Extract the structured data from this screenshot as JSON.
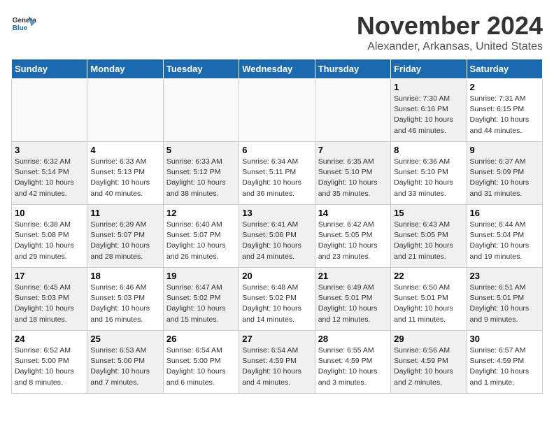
{
  "header": {
    "logo_general": "General",
    "logo_blue": "Blue",
    "month": "November 2024",
    "location": "Alexander, Arkansas, United States"
  },
  "weekdays": [
    "Sunday",
    "Monday",
    "Tuesday",
    "Wednesday",
    "Thursday",
    "Friday",
    "Saturday"
  ],
  "days": [
    {
      "num": "",
      "info": "",
      "empty": true
    },
    {
      "num": "",
      "info": "",
      "empty": true
    },
    {
      "num": "",
      "info": "",
      "empty": true
    },
    {
      "num": "",
      "info": "",
      "empty": true
    },
    {
      "num": "",
      "info": "",
      "empty": true
    },
    {
      "num": "1",
      "info": "Sunrise: 7:30 AM\nSunset: 6:16 PM\nDaylight: 10 hours\nand 46 minutes.",
      "shaded": true
    },
    {
      "num": "2",
      "info": "Sunrise: 7:31 AM\nSunset: 6:15 PM\nDaylight: 10 hours\nand 44 minutes.",
      "shaded": false
    },
    {
      "num": "3",
      "info": "Sunrise: 6:32 AM\nSunset: 5:14 PM\nDaylight: 10 hours\nand 42 minutes.",
      "shaded": true
    },
    {
      "num": "4",
      "info": "Sunrise: 6:33 AM\nSunset: 5:13 PM\nDaylight: 10 hours\nand 40 minutes.",
      "shaded": false
    },
    {
      "num": "5",
      "info": "Sunrise: 6:33 AM\nSunset: 5:12 PM\nDaylight: 10 hours\nand 38 minutes.",
      "shaded": true
    },
    {
      "num": "6",
      "info": "Sunrise: 6:34 AM\nSunset: 5:11 PM\nDaylight: 10 hours\nand 36 minutes.",
      "shaded": false
    },
    {
      "num": "7",
      "info": "Sunrise: 6:35 AM\nSunset: 5:10 PM\nDaylight: 10 hours\nand 35 minutes.",
      "shaded": true
    },
    {
      "num": "8",
      "info": "Sunrise: 6:36 AM\nSunset: 5:10 PM\nDaylight: 10 hours\nand 33 minutes.",
      "shaded": false
    },
    {
      "num": "9",
      "info": "Sunrise: 6:37 AM\nSunset: 5:09 PM\nDaylight: 10 hours\nand 31 minutes.",
      "shaded": true
    },
    {
      "num": "10",
      "info": "Sunrise: 6:38 AM\nSunset: 5:08 PM\nDaylight: 10 hours\nand 29 minutes.",
      "shaded": false
    },
    {
      "num": "11",
      "info": "Sunrise: 6:39 AM\nSunset: 5:07 PM\nDaylight: 10 hours\nand 28 minutes.",
      "shaded": true
    },
    {
      "num": "12",
      "info": "Sunrise: 6:40 AM\nSunset: 5:07 PM\nDaylight: 10 hours\nand 26 minutes.",
      "shaded": false
    },
    {
      "num": "13",
      "info": "Sunrise: 6:41 AM\nSunset: 5:06 PM\nDaylight: 10 hours\nand 24 minutes.",
      "shaded": true
    },
    {
      "num": "14",
      "info": "Sunrise: 6:42 AM\nSunset: 5:05 PM\nDaylight: 10 hours\nand 23 minutes.",
      "shaded": false
    },
    {
      "num": "15",
      "info": "Sunrise: 6:43 AM\nSunset: 5:05 PM\nDaylight: 10 hours\nand 21 minutes.",
      "shaded": true
    },
    {
      "num": "16",
      "info": "Sunrise: 6:44 AM\nSunset: 5:04 PM\nDaylight: 10 hours\nand 19 minutes.",
      "shaded": false
    },
    {
      "num": "17",
      "info": "Sunrise: 6:45 AM\nSunset: 5:03 PM\nDaylight: 10 hours\nand 18 minutes.",
      "shaded": true
    },
    {
      "num": "18",
      "info": "Sunrise: 6:46 AM\nSunset: 5:03 PM\nDaylight: 10 hours\nand 16 minutes.",
      "shaded": false
    },
    {
      "num": "19",
      "info": "Sunrise: 6:47 AM\nSunset: 5:02 PM\nDaylight: 10 hours\nand 15 minutes.",
      "shaded": true
    },
    {
      "num": "20",
      "info": "Sunrise: 6:48 AM\nSunset: 5:02 PM\nDaylight: 10 hours\nand 14 minutes.",
      "shaded": false
    },
    {
      "num": "21",
      "info": "Sunrise: 6:49 AM\nSunset: 5:01 PM\nDaylight: 10 hours\nand 12 minutes.",
      "shaded": true
    },
    {
      "num": "22",
      "info": "Sunrise: 6:50 AM\nSunset: 5:01 PM\nDaylight: 10 hours\nand 11 minutes.",
      "shaded": false
    },
    {
      "num": "23",
      "info": "Sunrise: 6:51 AM\nSunset: 5:01 PM\nDaylight: 10 hours\nand 9 minutes.",
      "shaded": true
    },
    {
      "num": "24",
      "info": "Sunrise: 6:52 AM\nSunset: 5:00 PM\nDaylight: 10 hours\nand 8 minutes.",
      "shaded": false
    },
    {
      "num": "25",
      "info": "Sunrise: 6:53 AM\nSunset: 5:00 PM\nDaylight: 10 hours\nand 7 minutes.",
      "shaded": true
    },
    {
      "num": "26",
      "info": "Sunrise: 6:54 AM\nSunset: 5:00 PM\nDaylight: 10 hours\nand 6 minutes.",
      "shaded": false
    },
    {
      "num": "27",
      "info": "Sunrise: 6:54 AM\nSunset: 4:59 PM\nDaylight: 10 hours\nand 4 minutes.",
      "shaded": true
    },
    {
      "num": "28",
      "info": "Sunrise: 6:55 AM\nSunset: 4:59 PM\nDaylight: 10 hours\nand 3 minutes.",
      "shaded": false
    },
    {
      "num": "29",
      "info": "Sunrise: 6:56 AM\nSunset: 4:59 PM\nDaylight: 10 hours\nand 2 minutes.",
      "shaded": true
    },
    {
      "num": "30",
      "info": "Sunrise: 6:57 AM\nSunset: 4:59 PM\nDaylight: 10 hours\nand 1 minute.",
      "shaded": false
    }
  ]
}
